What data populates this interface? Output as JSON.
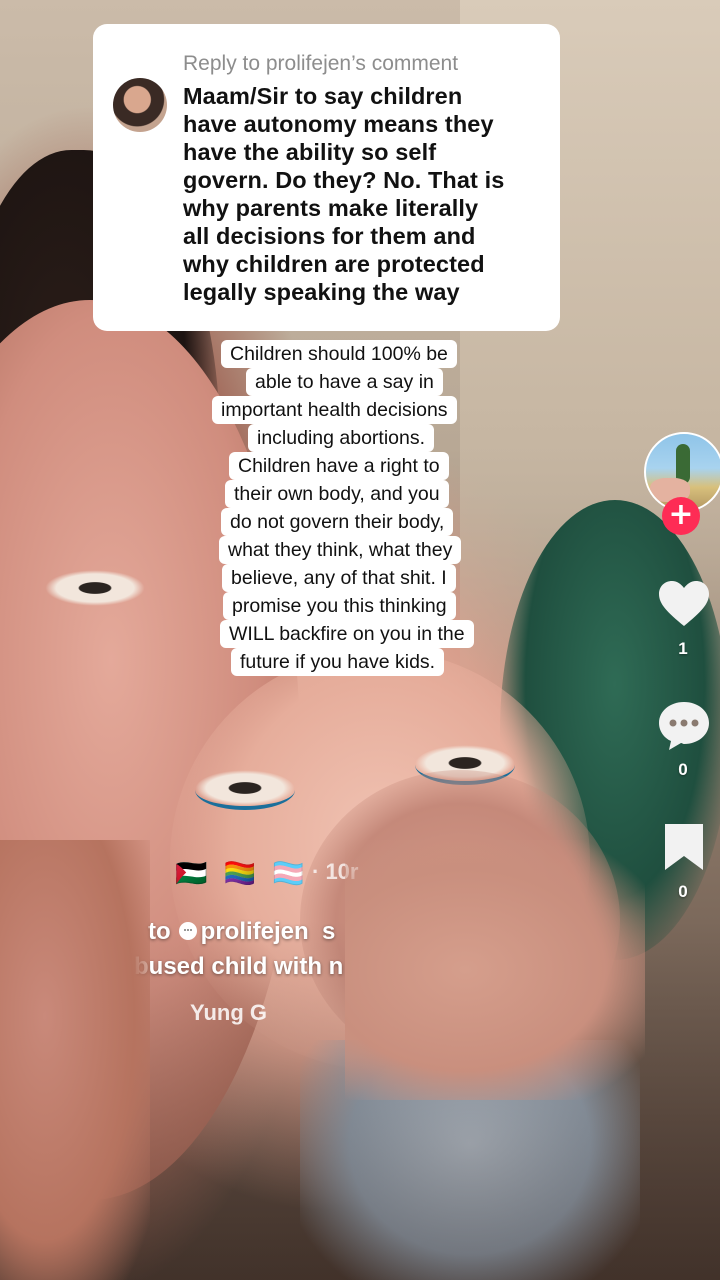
{
  "reply_card": {
    "title": "Reply to prolifejen’s comment",
    "comment_text": "Maam/Sir to say children\nhave autonomy means they\nhave the ability so self\ngovern. Do they? No. That is\nwhy parents make literally\nall decisions for them and\nwhy children are protected\nlegally speaking the way"
  },
  "caption_lines": [
    "Children should 100% be",
    "able to have a say in",
    "important health decisions",
    "including abortions.",
    "Children have a right to",
    "their own body, and you",
    "do not govern their body,",
    "what they think, what they",
    "believe, any of that shit. I",
    "promise you this thinking",
    "WILL backfire on you in the",
    "future if you have kids."
  ],
  "rail": {
    "follow_symbol": "+",
    "like_count": "1",
    "comment_count": "0",
    "save_count": "0",
    "colors": {
      "follow": "#fe2c55",
      "icon": "#ffffff"
    }
  },
  "meta": {
    "flags": "🇵🇸 🏳️‍🌈 🏳️‍⚧️",
    "time": "· 10r",
    "reply_prefix": "to",
    "reply_user": "prolifejen",
    "reply_suffix": "s",
    "description": "bused child with n",
    "music": "Yung G"
  }
}
